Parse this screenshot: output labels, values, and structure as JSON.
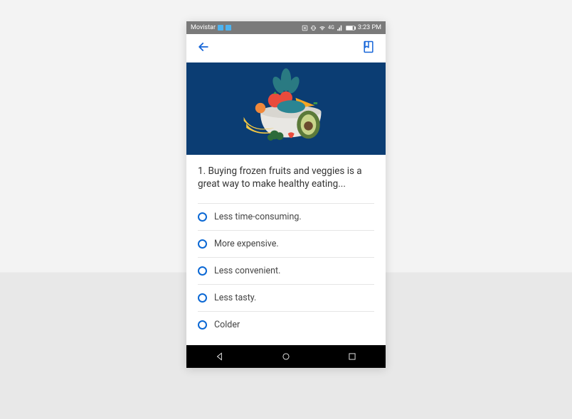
{
  "status_bar": {
    "carrier": "Movistar",
    "time": "3:23 PM",
    "network_label": "4G"
  },
  "question": {
    "number": "1",
    "text": "1. Buying frozen fruits and veggies is a great way to make healthy eating..."
  },
  "options": [
    {
      "label": "Less time-consuming."
    },
    {
      "label": "More expensive."
    },
    {
      "label": "Less convenient."
    },
    {
      "label": "Less tasty."
    },
    {
      "label": "Colder"
    }
  ],
  "colors": {
    "primary_blue": "#0b68d4",
    "hero_navy": "#0b3d73"
  }
}
